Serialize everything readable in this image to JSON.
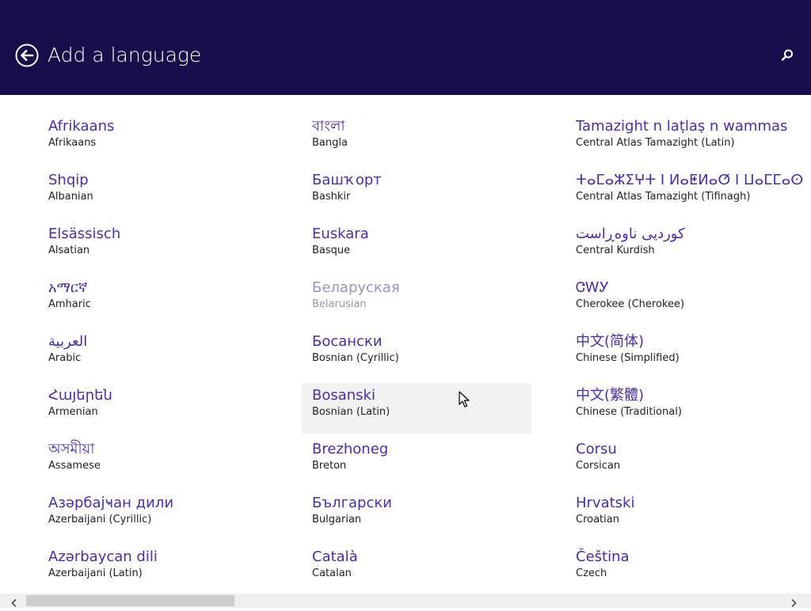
{
  "header": {
    "title": "Add a language",
    "back_icon": "back-arrow-icon",
    "search_icon": "search-icon",
    "background_color": "#180e49"
  },
  "languages": {
    "columns": [
      [
        {
          "native": "Afrikaans",
          "english": "Afrikaans"
        },
        {
          "native": "Shqip",
          "english": "Albanian"
        },
        {
          "native": "Elsässisch",
          "english": "Alsatian"
        },
        {
          "native": "አማርኛ",
          "english": "Amharic"
        },
        {
          "native": "العربية",
          "english": "Arabic"
        },
        {
          "native": "Հայերեն",
          "english": "Armenian"
        },
        {
          "native": "অসমীয়া",
          "english": "Assamese"
        },
        {
          "native": "Азәрбајҹан дили",
          "english": "Azerbaijani (Cyrillic)"
        },
        {
          "native": "Azərbaycan dili",
          "english": "Azerbaijani (Latin)"
        }
      ],
      [
        {
          "native": "বাংলা",
          "english": "Bangla"
        },
        {
          "native": "Башҡорт",
          "english": "Bashkir"
        },
        {
          "native": "Euskara",
          "english": "Basque"
        },
        {
          "native": "Беларуская",
          "english": "Belarusian",
          "state": "disabled"
        },
        {
          "native": "Босански",
          "english": "Bosnian (Cyrillic)"
        },
        {
          "native": "Bosanski",
          "english": "Bosnian (Latin)",
          "state": "hovered"
        },
        {
          "native": "Brezhoneg",
          "english": "Breton"
        },
        {
          "native": "Български",
          "english": "Bulgarian"
        },
        {
          "native": "Català",
          "english": "Catalan"
        }
      ],
      [
        {
          "native": "Tamazight n laṭlaṣ n wammas",
          "english": "Central Atlas Tamazight (Latin)"
        },
        {
          "native": "ⵜⴰⵎⴰⵣⵉⵖⵜ ⵏ ⵍⴰⵟⵍⴰⵚ ⵏ ⵡⴰⵎⵎⴰⵙ",
          "english": "Central Atlas Tamazight (Tifinagh)"
        },
        {
          "native": "کوردیی ناوەڕاست",
          "english": "Central Kurdish"
        },
        {
          "native": "ᏣᎳᎩ",
          "english": "Cherokee (Cherokee)"
        },
        {
          "native": "中文(简体)",
          "english": "Chinese (Simplified)"
        },
        {
          "native": "中文(繁體)",
          "english": "Chinese (Traditional)"
        },
        {
          "native": "Corsu",
          "english": "Corsican"
        },
        {
          "native": "Hrvatski",
          "english": "Croatian"
        },
        {
          "native": "Čeština",
          "english": "Czech"
        }
      ]
    ]
  },
  "colors": {
    "native_text": "#4a2fa0",
    "english_text": "#222222",
    "hover_bg": "#f2f2f2"
  }
}
